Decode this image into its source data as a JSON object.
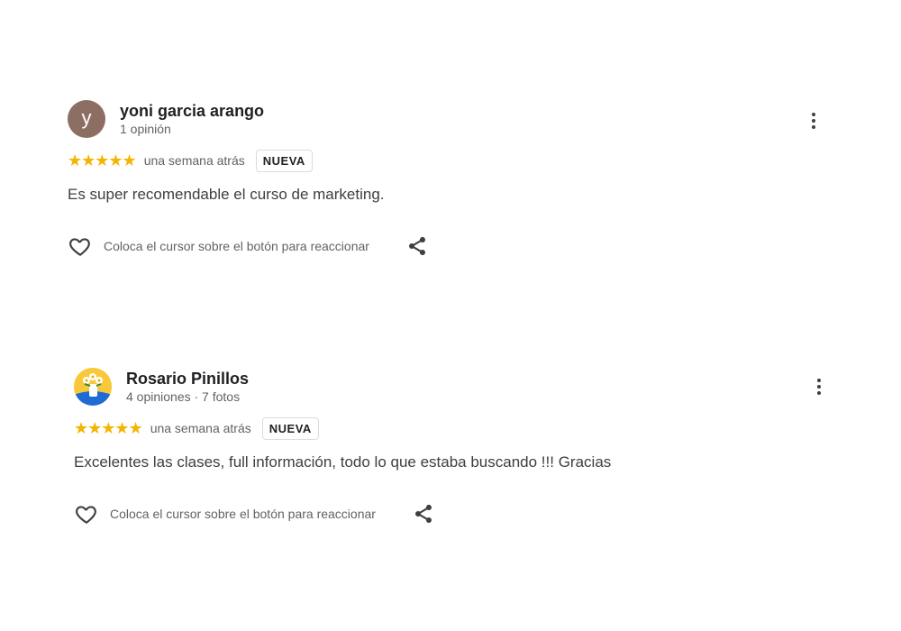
{
  "reviews": [
    {
      "author": "yoni garcia arango",
      "avatar_letter": "y",
      "avatar_color": "#8d6e63",
      "meta": "1 opinión",
      "stars": "★★★★★",
      "rating": 5,
      "date": "una semana atrás",
      "badge": "NUEVA",
      "text": "Es super recomendable el curso de marketing.",
      "react_label": "Coloca el cursor sobre el botón para reaccionar"
    },
    {
      "author": "Rosario Pinillos",
      "meta": "4 opiniones · 7 fotos",
      "stars": "★★★★★",
      "rating": 5,
      "date": "una semana atrás",
      "badge": "NUEVA",
      "text": "Excelentes las clases, full información, todo lo que estaba buscando !!! Gracias",
      "react_label": "Coloca el cursor sobre el botón para reaccionar"
    }
  ],
  "colors": {
    "star": "#f4b400",
    "muted": "#5f6368",
    "text": "#3c4043"
  },
  "icons": {
    "more": "more-vert-icon",
    "heart": "heart-outline-icon",
    "share": "share-icon"
  }
}
